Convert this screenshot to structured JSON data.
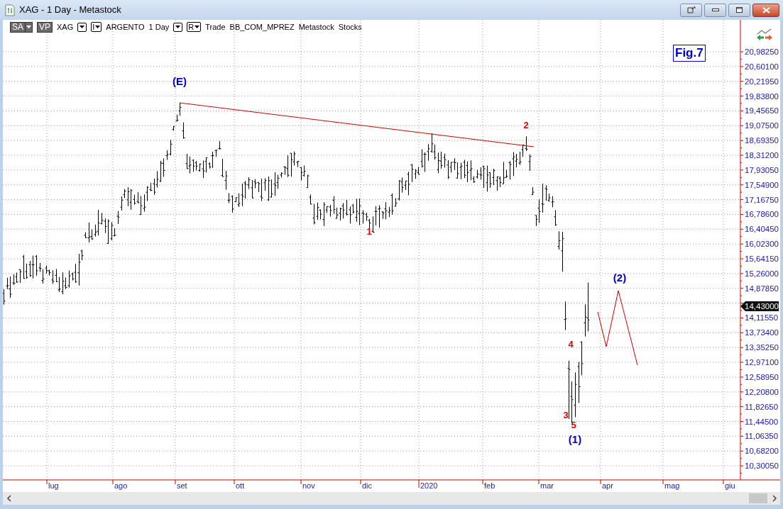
{
  "window": {
    "title": "XAG - 1 Day - Metastock"
  },
  "toolbar": {
    "items": [
      {
        "kind": "split",
        "text": "SA"
      },
      {
        "kind": "chip",
        "text": "VP"
      },
      {
        "kind": "text",
        "text": "XAG"
      },
      {
        "kind": "dropdown"
      },
      {
        "kind": "menu",
        "text": "I"
      },
      {
        "kind": "text",
        "text": "ARGENTO"
      },
      {
        "kind": "text",
        "text": "1 Day"
      },
      {
        "kind": "dropdown"
      },
      {
        "kind": "menu",
        "text": "R"
      },
      {
        "kind": "text",
        "text": "Trade"
      },
      {
        "kind": "text",
        "text": "BB_COM_MPREZ"
      },
      {
        "kind": "text",
        "text": "Metastock"
      },
      {
        "kind": "text",
        "text": "Stocks"
      }
    ]
  },
  "chart": {
    "figure_label": "Fig.7",
    "last_price": "14,43000",
    "y_axis_labels": [
      "20,98250",
      "20,60100",
      "20,21950",
      "19,83800",
      "19,45650",
      "19,07500",
      "18,69350",
      "18,31200",
      "17,93050",
      "17,54900",
      "17,16750",
      "16,78600",
      "16,40450",
      "16,02300",
      "15,64150",
      "15,26000",
      "14,87850",
      "14,11550",
      "13,73400",
      "13,35250",
      "12,97100",
      "12,58950",
      "12,20800",
      "11,82650",
      "11,44500",
      "11,06350",
      "10,68200",
      "10,30050"
    ],
    "x_axis_labels": [
      "lug",
      "ago",
      "set",
      "ott",
      "nov",
      "dic",
      "2020",
      "feb",
      "mar",
      "apr",
      "mag",
      "giu"
    ],
    "annotations": [
      {
        "text": "(E)",
        "color": "#0000cc"
      },
      {
        "text": "1",
        "color": "#dd0000"
      },
      {
        "text": "2",
        "color": "#dd0000"
      },
      {
        "text": "4",
        "color": "#dd0000"
      },
      {
        "text": "3",
        "color": "#dd0000"
      },
      {
        "text": "5",
        "color": "#dd0000"
      },
      {
        "text": "(1)",
        "color": "#0000cc"
      },
      {
        "text": "(2)",
        "color": "#0000cc"
      }
    ]
  }
}
